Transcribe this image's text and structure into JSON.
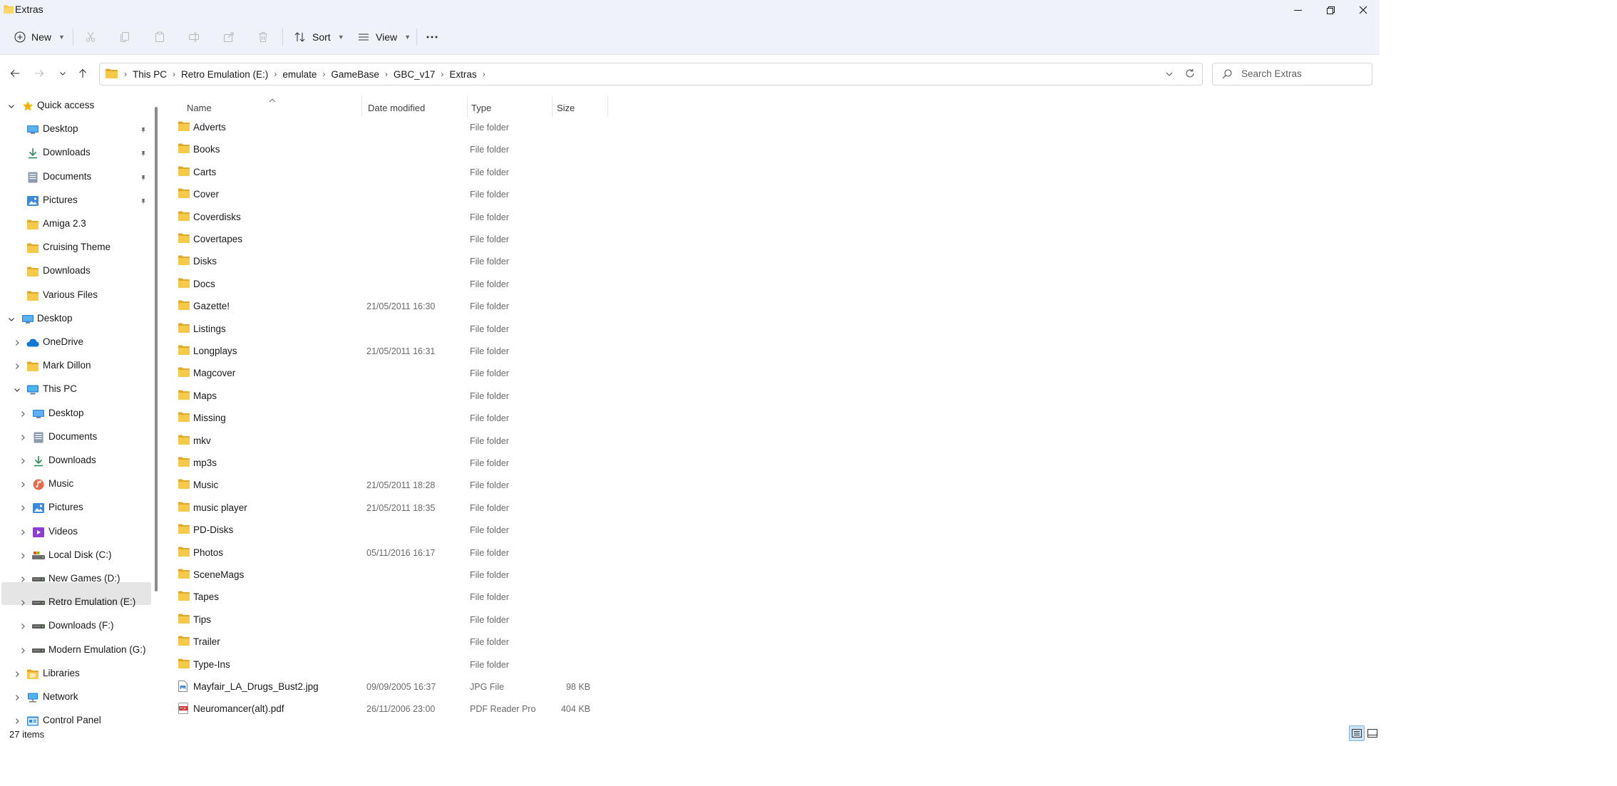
{
  "window": {
    "title": "Extras"
  },
  "commandbar": {
    "new_label": "New",
    "sort_label": "Sort",
    "view_label": "View"
  },
  "breadcrumb": [
    "This PC",
    "Retro Emulation (E:)",
    "emulate",
    "GameBase",
    "GBC_v17",
    "Extras"
  ],
  "search": {
    "placeholder": "Search Extras"
  },
  "sidebar": {
    "quick_access_label": "Quick access",
    "quick_access": [
      {
        "label": "Desktop",
        "icon": "desktop-icon",
        "pinned": true
      },
      {
        "label": "Downloads",
        "icon": "download-icon",
        "pinned": true
      },
      {
        "label": "Documents",
        "icon": "documents-icon",
        "pinned": true
      },
      {
        "label": "Pictures",
        "icon": "pictures-icon",
        "pinned": true
      },
      {
        "label": "Amiga 2.3",
        "icon": "folder-icon",
        "pinned": false
      },
      {
        "label": "Cruising Theme",
        "icon": "folder-icon",
        "pinned": false
      },
      {
        "label": "Downloads",
        "icon": "folder-icon",
        "pinned": false
      },
      {
        "label": "Various Files",
        "icon": "folder-icon",
        "pinned": false
      }
    ],
    "desktop_label": "Desktop",
    "desktop_children": [
      {
        "label": "OneDrive",
        "icon": "cloud-icon"
      },
      {
        "label": "Mark Dillon",
        "icon": "folder-icon"
      }
    ],
    "this_pc_label": "This PC",
    "this_pc_children": [
      {
        "label": "Desktop",
        "icon": "desktop-icon"
      },
      {
        "label": "Documents",
        "icon": "documents-icon"
      },
      {
        "label": "Downloads",
        "icon": "download-icon"
      },
      {
        "label": "Music",
        "icon": "music-icon"
      },
      {
        "label": "Pictures",
        "icon": "pictures-icon"
      },
      {
        "label": "Videos",
        "icon": "videos-icon"
      },
      {
        "label": "Local Disk (C:)",
        "icon": "local-disk-icon"
      },
      {
        "label": "New Games (D:)",
        "icon": "drive-icon"
      },
      {
        "label": "Retro Emulation (E:)",
        "icon": "drive-icon",
        "selected": true
      },
      {
        "label": "Downloads (F:)",
        "icon": "drive-icon"
      },
      {
        "label": "Modern Emulation (G:)",
        "icon": "drive-icon"
      }
    ],
    "bottom": [
      {
        "label": "Libraries",
        "icon": "libraries-icon"
      },
      {
        "label": "Network",
        "icon": "network-icon"
      },
      {
        "label": "Control Panel",
        "icon": "control-panel-icon"
      }
    ]
  },
  "columns": {
    "name": "Name",
    "date": "Date modified",
    "type": "Type",
    "size": "Size"
  },
  "files": [
    {
      "name": "Adverts",
      "date": "",
      "type": "File folder",
      "size": "",
      "kind": "folder"
    },
    {
      "name": "Books",
      "date": "",
      "type": "File folder",
      "size": "",
      "kind": "folder"
    },
    {
      "name": "Carts",
      "date": "",
      "type": "File folder",
      "size": "",
      "kind": "folder"
    },
    {
      "name": "Cover",
      "date": "",
      "type": "File folder",
      "size": "",
      "kind": "folder"
    },
    {
      "name": "Coverdisks",
      "date": "",
      "type": "File folder",
      "size": "",
      "kind": "folder"
    },
    {
      "name": "Covertapes",
      "date": "",
      "type": "File folder",
      "size": "",
      "kind": "folder"
    },
    {
      "name": "Disks",
      "date": "",
      "type": "File folder",
      "size": "",
      "kind": "folder"
    },
    {
      "name": "Docs",
      "date": "",
      "type": "File folder",
      "size": "",
      "kind": "folder"
    },
    {
      "name": "Gazette!",
      "date": "21/05/2011 16:30",
      "type": "File folder",
      "size": "",
      "kind": "folder"
    },
    {
      "name": "Listings",
      "date": "",
      "type": "File folder",
      "size": "",
      "kind": "folder"
    },
    {
      "name": "Longplays",
      "date": "21/05/2011 16:31",
      "type": "File folder",
      "size": "",
      "kind": "folder"
    },
    {
      "name": "Magcover",
      "date": "",
      "type": "File folder",
      "size": "",
      "kind": "folder"
    },
    {
      "name": "Maps",
      "date": "",
      "type": "File folder",
      "size": "",
      "kind": "folder"
    },
    {
      "name": "Missing",
      "date": "",
      "type": "File folder",
      "size": "",
      "kind": "folder"
    },
    {
      "name": "mkv",
      "date": "",
      "type": "File folder",
      "size": "",
      "kind": "folder"
    },
    {
      "name": "mp3s",
      "date": "",
      "type": "File folder",
      "size": "",
      "kind": "folder"
    },
    {
      "name": "Music",
      "date": "21/05/2011 18:28",
      "type": "File folder",
      "size": "",
      "kind": "folder"
    },
    {
      "name": "music player",
      "date": "21/05/2011 18:35",
      "type": "File folder",
      "size": "",
      "kind": "folder"
    },
    {
      "name": "PD-Disks",
      "date": "",
      "type": "File folder",
      "size": "",
      "kind": "folder"
    },
    {
      "name": "Photos",
      "date": "05/11/2016 16:17",
      "type": "File folder",
      "size": "",
      "kind": "folder"
    },
    {
      "name": "SceneMags",
      "date": "",
      "type": "File folder",
      "size": "",
      "kind": "folder"
    },
    {
      "name": "Tapes",
      "date": "",
      "type": "File folder",
      "size": "",
      "kind": "folder"
    },
    {
      "name": "Tips",
      "date": "",
      "type": "File folder",
      "size": "",
      "kind": "folder"
    },
    {
      "name": "Trailer",
      "date": "",
      "type": "File folder",
      "size": "",
      "kind": "folder"
    },
    {
      "name": "Type-Ins",
      "date": "",
      "type": "File folder",
      "size": "",
      "kind": "folder"
    },
    {
      "name": "Mayfair_LA_Drugs_Bust2.jpg",
      "date": "09/09/2005 16:37",
      "type": "JPG File",
      "size": "98 KB",
      "kind": "image"
    },
    {
      "name": "Neuromancer(alt).pdf",
      "date": "26/11/2006 23:00",
      "type": "PDF Reader Pro",
      "size": "404 KB",
      "kind": "pdf"
    }
  ],
  "status": {
    "item_count": "27 items"
  },
  "colors": {
    "folder": "#f7c948",
    "folder_dark": "#e0a92a",
    "accent": "#0067c0",
    "selected": "#e5e5e5"
  }
}
